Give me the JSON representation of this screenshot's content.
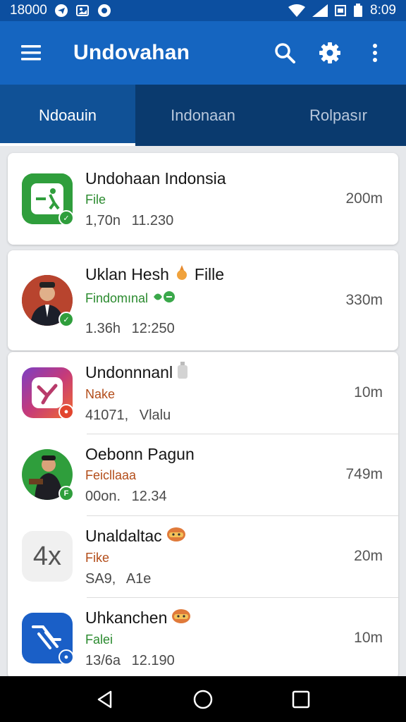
{
  "status_bar": {
    "left_text": "18000",
    "time": "8:09"
  },
  "app_bar": {
    "title": "Undovahan",
    "icons": [
      "menu-icon",
      "search-icon",
      "settings-icon",
      "more-vert-icon"
    ]
  },
  "tabs": [
    {
      "label": "Ndoauin",
      "active": true
    },
    {
      "label": "Indonaan",
      "active": false
    },
    {
      "label": "Rolpasır",
      "active": false
    }
  ],
  "items": [
    {
      "title": "Undohaan Indonsia",
      "subtitle": "File",
      "meta": "1,70n 11.230",
      "size": "200m",
      "subtitle_color": "#2a8a2e"
    },
    {
      "title": "Uklan Hesh",
      "title_suffix": "Fille",
      "subtitle": "Findomınal",
      "meta": "1.36h 12:250",
      "size": "330m",
      "subtitle_color": "#2a8a2e"
    },
    {
      "title": "Undonnnanl",
      "subtitle": "Nake",
      "meta": "41071, Vlalu",
      "size": "10m",
      "subtitle_color": "#b34d1a"
    },
    {
      "title": "Oebonn Pagun",
      "subtitle": "Feicllaaa",
      "meta": "00on. 12.34",
      "size": "749m",
      "subtitle_color": "#b34d1a"
    },
    {
      "title": "Unaldaltac",
      "subtitle": "Fike",
      "meta": "SA9, A1e",
      "size": "20m",
      "subtitle_color": "#b34d1a"
    },
    {
      "title": "Uhkanchen",
      "subtitle": "Falei",
      "meta": "13/6a 12.190",
      "size": "10m",
      "subtitle_color": "#2a8a2e"
    }
  ],
  "item_icons": {
    "logo_text": "4x"
  }
}
